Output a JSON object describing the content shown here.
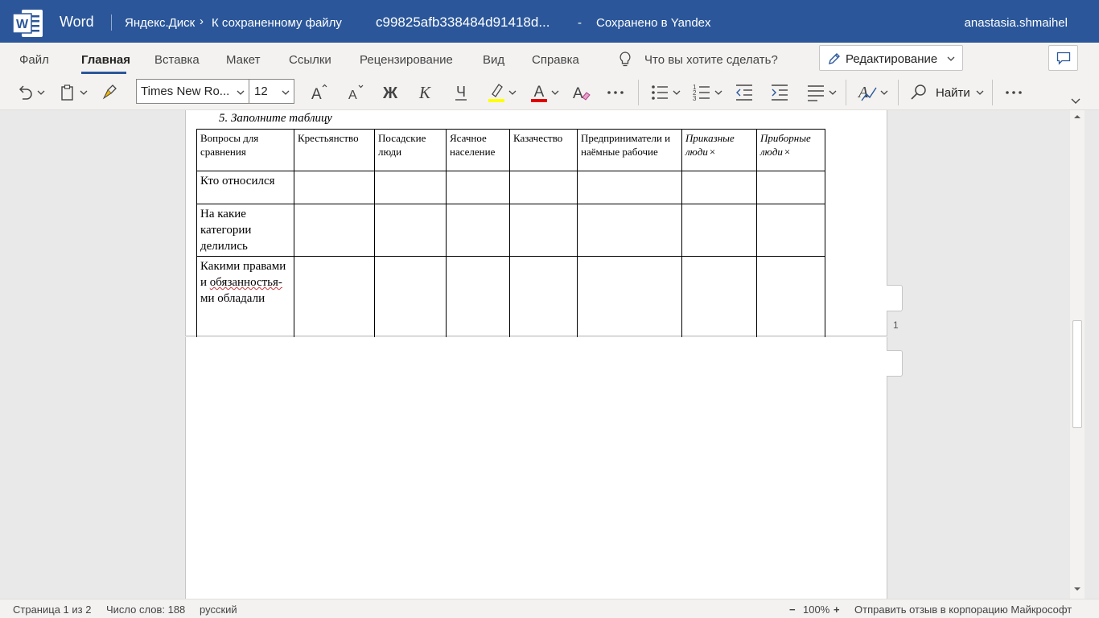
{
  "titlebar": {
    "app_name": "Word",
    "breadcrumb_root": "Яндекс.Диск",
    "breadcrumb_link": "К сохраненному файлу",
    "doc_name": "c99825afb338484d91418d...",
    "separator": "-",
    "save_status": "Сохранено в Yandex",
    "user": "anastasia.shmaihel",
    "brand_color": "#2b579a"
  },
  "menu": {
    "items": [
      "Файл",
      "Главная",
      "Вставка",
      "Макет",
      "Ссылки",
      "Рецензирование",
      "Вид",
      "Справка"
    ],
    "active": "Главная",
    "tell_me": "Что вы хотите сделать?",
    "editing_mode": "Редактирование"
  },
  "ribbon": {
    "font_name": "Times New Ro...",
    "font_size": "12",
    "bold_glyph": "Ж",
    "italic_glyph": "К",
    "underline_glyph": "Ч",
    "find_label": "Найти",
    "highlight_color": "#ffff00",
    "font_color": "#e00000"
  },
  "document": {
    "heading": "5. Заполните таблицу",
    "table": {
      "headers": [
        "Вопросы для сравнения",
        "Крестьянство",
        "Посадские люди",
        "Ясачное население",
        "Казачество",
        "Предприниматели и наёмные рабочие",
        "Приказные люди",
        "Приборные люди"
      ],
      "header_marks": [
        "",
        "",
        "",
        "",
        "",
        "",
        "×",
        "×"
      ],
      "rows": [
        [
          "Кто относился",
          "",
          "",
          "",
          "",
          "",
          "",
          ""
        ],
        [
          "На какие категории делились",
          "",
          "",
          "",
          "",
          "",
          "",
          ""
        ],
        [
          "Какими правами и обязанностья-ми обладали",
          "",
          "",
          "",
          "",
          "",
          "",
          ""
        ]
      ],
      "row3_parts": [
        "Какими правами и ",
        "обязанностья-",
        "ми обладали"
      ]
    },
    "page_number": "1"
  },
  "status": {
    "page": "Страница 1 из 2",
    "words": "Число слов: 188",
    "language": "русский",
    "zoom_minus": "−",
    "zoom": "100%",
    "zoom_plus": "+",
    "feedback": "Отправить отзыв в корпорацию Майкрософт"
  }
}
